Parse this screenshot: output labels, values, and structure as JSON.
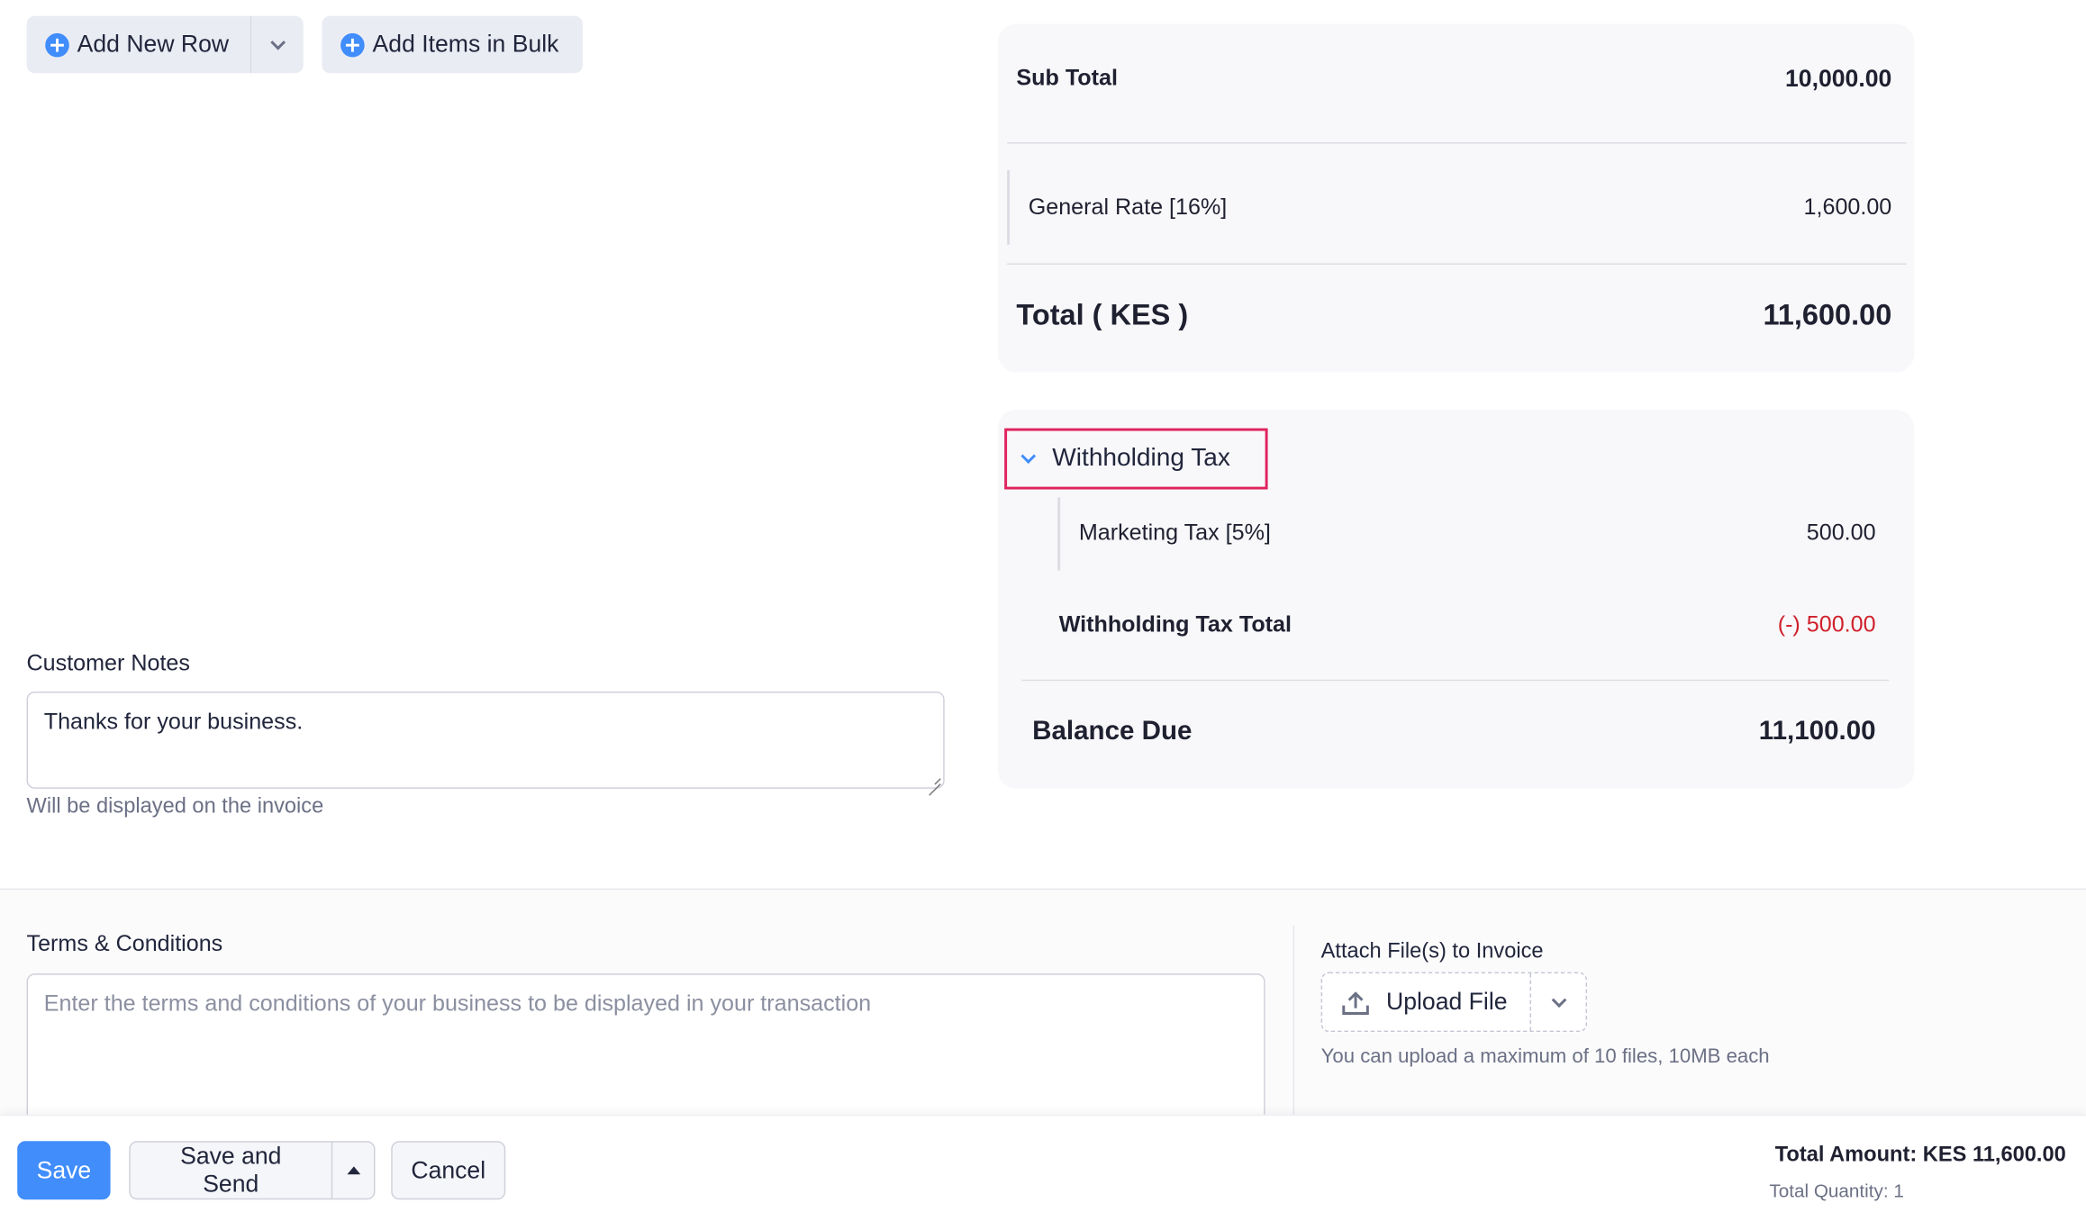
{
  "toolbar": {
    "add_new_row": "Add New Row",
    "add_items_bulk": "Add Items in Bulk"
  },
  "summary": {
    "sub_total_label": "Sub Total",
    "sub_total_value": "10,000.00",
    "tax_label": "General Rate [16%]",
    "tax_value": "1,600.00",
    "total_label": "Total ( KES )",
    "total_value": "11,600.00"
  },
  "withholding": {
    "toggle_label": "Withholding Tax",
    "item_label": "Marketing Tax [5%]",
    "item_value": "500.00",
    "total_label": "Withholding Tax Total",
    "total_value": "(-) 500.00",
    "balance_label": "Balance Due",
    "balance_value": "11,100.00"
  },
  "notes": {
    "label": "Customer Notes",
    "value": "Thanks for your business.",
    "hint": "Will be displayed on the invoice"
  },
  "terms": {
    "label": "Terms & Conditions",
    "placeholder": "Enter the terms and conditions of your business to be displayed in your transaction"
  },
  "attachments": {
    "label": "Attach File(s) to Invoice",
    "upload_label": "Upload File",
    "hint": "You can upload a maximum of 10 files, 10MB each"
  },
  "footer": {
    "save": "Save",
    "save_send": "Save and Send",
    "cancel": "Cancel",
    "total_amount": "Total Amount: KES 11,600.00",
    "total_quantity": "Total Quantity: 1"
  },
  "colors": {
    "accent": "#408dfb",
    "highlight_border": "#e0245e",
    "negative": "#d0202a"
  }
}
